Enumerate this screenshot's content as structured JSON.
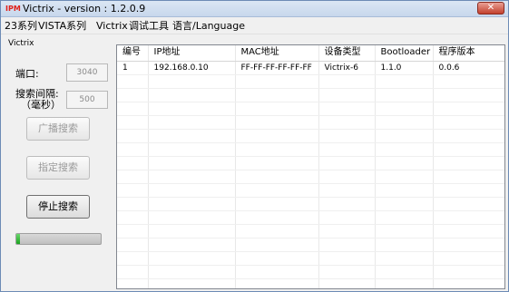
{
  "window": {
    "title": "Victrix - version : 1.2.0.9",
    "icon_text": "IPM",
    "close_icon": "close-icon"
  },
  "menu": [
    "23系列",
    "VISTA系列",
    "Victrix",
    "调试工具",
    "语言/Language"
  ],
  "panel": {
    "group_title": "Victrix",
    "port_label": "端口:",
    "port_value": "3040",
    "interval_label_1": "搜索间隔:",
    "interval_label_2": "（毫秒）",
    "interval_value": "500",
    "broadcast_button": "广播搜索",
    "specified_button": "指定搜索",
    "stop_button": "停止搜索",
    "progress_fraction": 0.04
  },
  "table": {
    "headers": [
      "编号",
      "IP地址",
      "MAC地址",
      "设备类型",
      "Bootloader",
      "程序版本"
    ],
    "rows": [
      [
        "1",
        "192.168.0.10",
        "FF-FF-FF-FF-FF-FF",
        "Victrix-6",
        "1.1.0",
        "0.0.6"
      ]
    ]
  },
  "colors": {
    "progress": "#1aa31f",
    "close_button": "#c3402d"
  }
}
